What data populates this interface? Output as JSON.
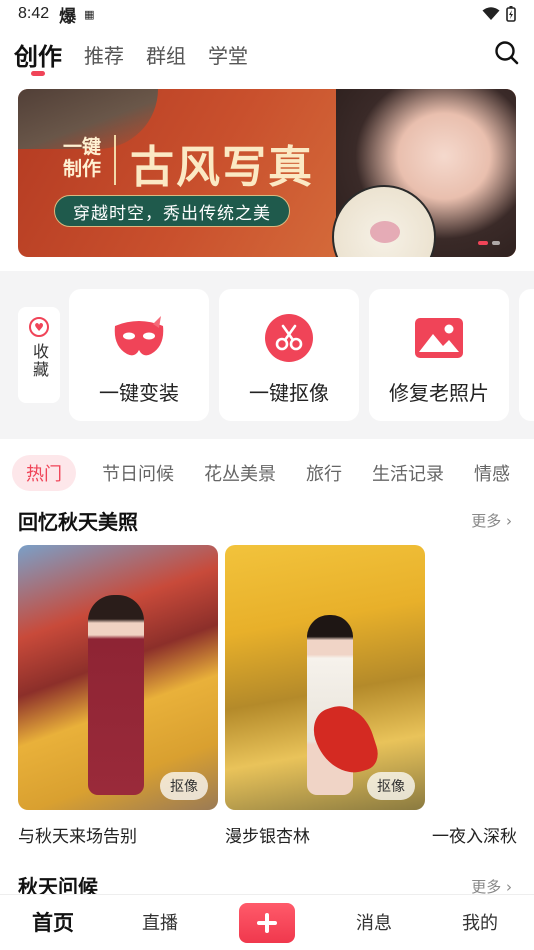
{
  "status_bar": {
    "time": "8:42",
    "notif_glyph": "爆",
    "qr_glyph": "▦"
  },
  "top_tabs": [
    {
      "label": "创作"
    },
    {
      "label": "推荐"
    },
    {
      "label": "群组"
    },
    {
      "label": "学堂"
    }
  ],
  "banner": {
    "one_key": "一键制作",
    "title": "古风写真",
    "slogan": "穿越时空，秀出传统之美",
    "page_count": 2,
    "active_page": 1
  },
  "tools": {
    "favorite_label": "收藏",
    "items": [
      {
        "label": "一键变装",
        "icon": "mask-icon"
      },
      {
        "label": "一键抠像",
        "icon": "scissors-icon"
      },
      {
        "label": "修复老照片",
        "icon": "photo-icon"
      }
    ]
  },
  "categories": [
    "热门",
    "节日问候",
    "花丛美景",
    "旅行",
    "生活记录",
    "情感"
  ],
  "section1": {
    "title": "回忆秋天美照",
    "more": "更多",
    "items": [
      {
        "caption": "与秋天来场告别",
        "badge": "抠像"
      },
      {
        "caption": "漫步银杏林",
        "badge": "抠像"
      },
      {
        "caption": "一夜入深秋"
      }
    ]
  },
  "section2": {
    "title": "秋天问候",
    "more": "更多"
  },
  "bottom_nav": {
    "home": "首页",
    "live": "直播",
    "messages": "消息",
    "mine": "我的"
  },
  "colors": {
    "accent": "#f04458",
    "banner_pill": "#1f5a4c"
  }
}
